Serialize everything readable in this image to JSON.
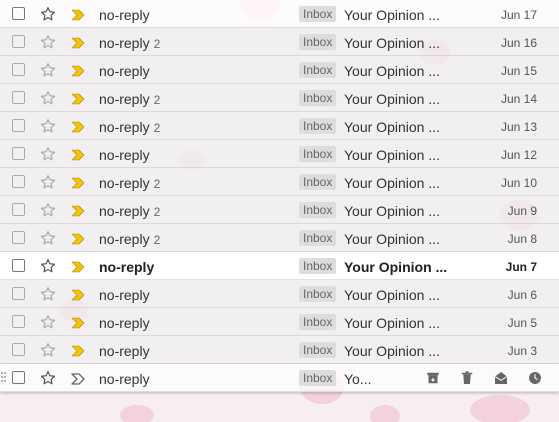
{
  "colors": {
    "importance_marker": "#f4c20d",
    "label_bg": "#dddddd"
  },
  "icons": {
    "checkbox": "checkbox-icon",
    "star": "star-icon",
    "importance": "importance-marker-icon",
    "archive": "archive-icon",
    "delete": "trash-icon",
    "mark_read": "open-envelope-icon",
    "snooze": "clock-icon"
  },
  "rows": [
    {
      "sender": "no-reply",
      "count": "",
      "label": "Inbox",
      "subject": "Your Opinion ...",
      "date": "Jun 17",
      "read": false,
      "unread": false
    },
    {
      "sender": "no-reply",
      "count": "2",
      "label": "Inbox",
      "subject": "Your Opinion ...",
      "date": "Jun 16",
      "read": true,
      "unread": false
    },
    {
      "sender": "no-reply",
      "count": "",
      "label": "Inbox",
      "subject": "Your Opinion ...",
      "date": "Jun 15",
      "read": true,
      "unread": false
    },
    {
      "sender": "no-reply",
      "count": "2",
      "label": "Inbox",
      "subject": "Your Opinion ...",
      "date": "Jun 14",
      "read": true,
      "unread": false
    },
    {
      "sender": "no-reply",
      "count": "2",
      "label": "Inbox",
      "subject": "Your Opinion ...",
      "date": "Jun 13",
      "read": true,
      "unread": false
    },
    {
      "sender": "no-reply",
      "count": "",
      "label": "Inbox",
      "subject": "Your Opinion ...",
      "date": "Jun 12",
      "read": true,
      "unread": false
    },
    {
      "sender": "no-reply",
      "count": "2",
      "label": "Inbox",
      "subject": "Your Opinion ...",
      "date": "Jun 10",
      "read": true,
      "unread": false
    },
    {
      "sender": "no-reply",
      "count": "2",
      "label": "Inbox",
      "subject": "Your Opinion ...",
      "date": "Jun 9",
      "read": true,
      "unread": false
    },
    {
      "sender": "no-reply",
      "count": "2",
      "label": "Inbox",
      "subject": "Your Opinion ...",
      "date": "Jun 8",
      "read": true,
      "unread": false
    },
    {
      "sender": "no-reply",
      "count": "",
      "label": "Inbox",
      "subject": "Your Opinion ...",
      "date": "Jun 7",
      "read": false,
      "unread": true
    },
    {
      "sender": "no-reply",
      "count": "",
      "label": "Inbox",
      "subject": "Your Opinion ...",
      "date": "Jun 6",
      "read": true,
      "unread": false
    },
    {
      "sender": "no-reply",
      "count": "",
      "label": "Inbox",
      "subject": "Your Opinion ...",
      "date": "Jun 5",
      "read": true,
      "unread": false
    },
    {
      "sender": "no-reply",
      "count": "",
      "label": "Inbox",
      "subject": "Your Opinion ...",
      "date": "Jun 3",
      "read": true,
      "unread": false
    },
    {
      "sender": "no-reply",
      "count": "",
      "label": "Inbox",
      "subject": "Yo...",
      "date": "",
      "read": false,
      "unread": false,
      "hover": true
    }
  ]
}
